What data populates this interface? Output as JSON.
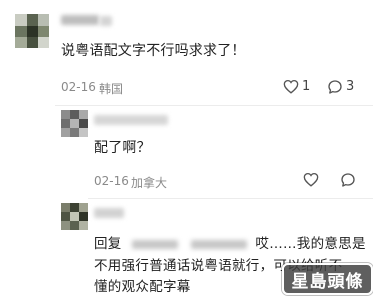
{
  "comments": [
    {
      "text": "说粤语配文字不行吗求求了！",
      "date": "02-16",
      "location": "韩国",
      "likes": "1",
      "replies": "3"
    },
    {
      "text": "配了啊？",
      "date": "02-16",
      "location": "加拿大"
    },
    {
      "reply_prefix": "回复",
      "reply_line1_rest": "哎……我的意思是",
      "reply_line2": "不用强行普通话说粤语就行，可以给听不",
      "reply_line3": "懂的观众配字幕"
    }
  ],
  "watermark": "星島頭條",
  "icons": {
    "like": "heart-icon",
    "reply": "speech-bubble-icon",
    "avatar": "pixelated-avatar"
  }
}
